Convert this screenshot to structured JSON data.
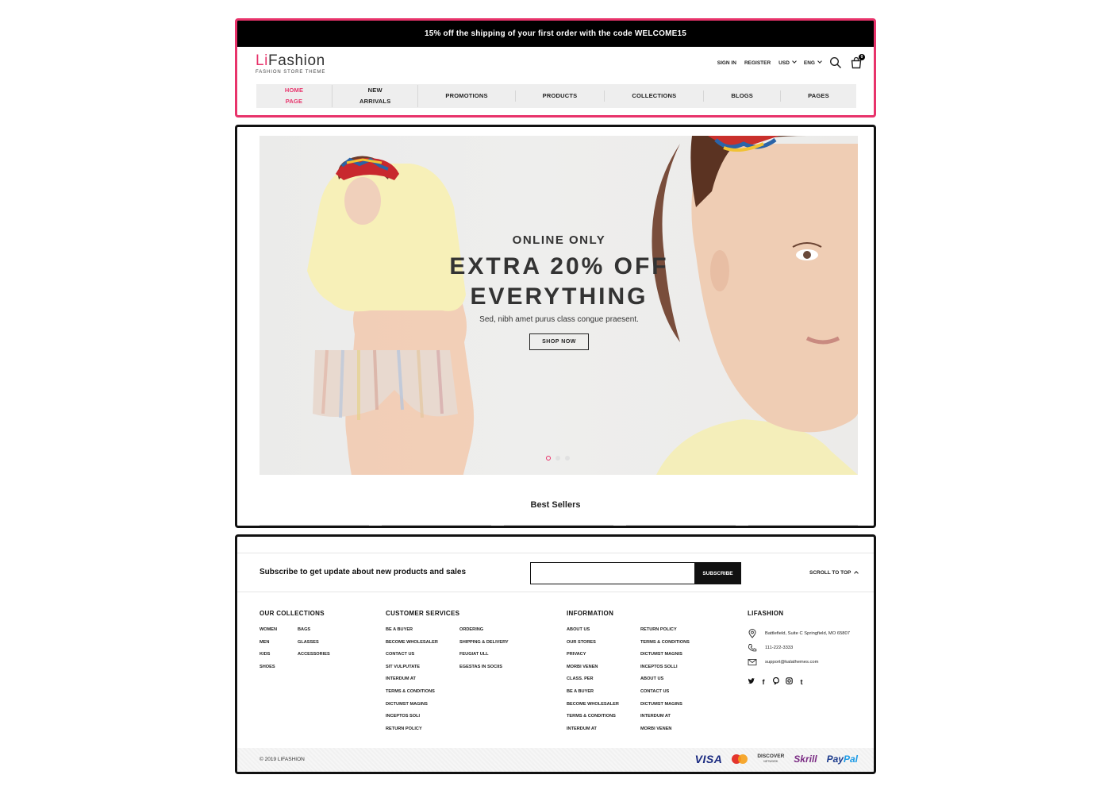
{
  "promo": {
    "text": "15% off the shipping of your first order with the code WELCOME15"
  },
  "brand": {
    "name_accent": "Li",
    "name_rest": "Fashion",
    "tagline": "FASHION STORE THEME"
  },
  "header": {
    "sign_in": "SIGN IN",
    "register": "REGISTER",
    "currency": "USD",
    "language": "ENG",
    "cart_count": "0",
    "icons": [
      "search-icon",
      "cart-icon",
      "chevron-down-icon"
    ]
  },
  "nav": {
    "items": [
      "HOME PAGE",
      "NEW ARRIVALS",
      "PROMOTIONS",
      "PRODUCTS",
      "COLLECTIONS",
      "BLOGS",
      "PAGES"
    ],
    "active_index": 0
  },
  "hero": {
    "kicker": "ONLINE ONLY",
    "title_line1": "EXTRA 20% OFF",
    "title_line2": "EVERYTHING",
    "description": "Sed, nibh amet purus class congue praesent.",
    "button": "SHOP NOW",
    "slides_total": 3,
    "active_slide": 1
  },
  "best_sellers": {
    "title": "Best Sellers"
  },
  "newsletter": {
    "text": "Subscribe to get update about new products and sales",
    "input_value": "",
    "button": "SUBSCRIBE",
    "scroll_top": "SCROLL TO TOP"
  },
  "footer": {
    "collections": {
      "title": "OUR COLLECTIONS",
      "col1": [
        "WOMEN",
        "MEN",
        "KIDS",
        "SHOES"
      ],
      "col2": [
        "BAGS",
        "GLASSES",
        "ACCESSORIES"
      ]
    },
    "customer_services": {
      "title": "CUSTOMER SERVICES",
      "col1": [
        "BE A BUYER",
        "BECOME WHOLESALER",
        "CONTACT US",
        "SIT VULPUTATE",
        "INTERDUM AT",
        "TERMS & CONDITIONS",
        "DICTUMST MAGINS",
        "INCEPTOS SOLI",
        "RETURN POLICY"
      ],
      "col2": [
        "ORDERING",
        "SHIPPING & DELIVERY",
        "FEUGIAT ULL",
        "EGESTAS IN SOCIIS"
      ]
    },
    "information": {
      "title": "INFORMATION",
      "col1": [
        "ABOUT US",
        "OUR STORES",
        "PRIVACY",
        "MORBI VENEN",
        "CLASS. PER",
        "BE A BUYER",
        "BECOME WHOLESALER",
        "TERMS & CONDITIONS",
        "INTERDUM AT"
      ],
      "col2": [
        "RETURN POLICY",
        "TERMS & CONDITIONS",
        "DICTUMST MAGNIS",
        "INCEPTOS SOLLI",
        "ABOUT US",
        "CONTACT US",
        "DICTUMST MAGINS",
        "INTERDUM AT",
        "MORBI VENEN"
      ]
    },
    "company": {
      "title": "LIFASHION",
      "address": "Battlefield, Suite C Springfield, MO 65807",
      "phone": "111-222-3333",
      "email": "support@kalathemes.com",
      "social_icons": [
        "twitter-icon",
        "facebook-icon",
        "pinterest-icon",
        "instagram-icon",
        "tumblr-icon"
      ]
    },
    "copyright": "© 2019 LIFASHION",
    "payments": {
      "visa": "VISA",
      "discover": "DISCOVER",
      "discover_sub": "NETWORK",
      "skrill": "Skrill",
      "paypal_a": "Pay",
      "paypal_b": "Pal"
    }
  },
  "colors": {
    "accent": "#e8336b",
    "dark": "#111111",
    "nav_bg": "#eeeeee"
  }
}
